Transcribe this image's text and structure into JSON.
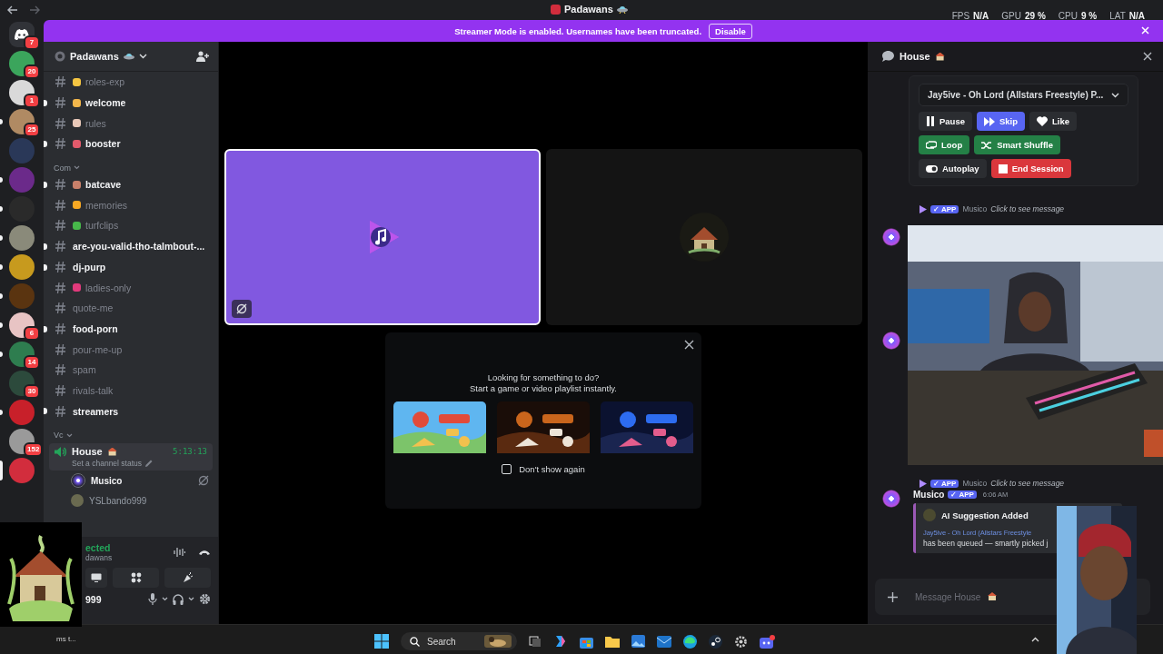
{
  "titlebar": {
    "title": "Padawans",
    "stats": [
      {
        "label": "FPS",
        "value": "N/A"
      },
      {
        "label": "GPU",
        "value": "29 %"
      },
      {
        "label": "CPU",
        "value": "9 %"
      },
      {
        "label": "LAT",
        "value": "N/A"
      }
    ]
  },
  "banner": {
    "text": "Streamer Mode is enabled. Usernames have been truncated.",
    "button": "Disable"
  },
  "servers": [
    {
      "kind": "home",
      "color": "#313338",
      "badge": "7",
      "unread": false,
      "selected": false
    },
    {
      "kind": "server",
      "color": "#3ba55c",
      "badge": "20",
      "unread": false,
      "selected": false
    },
    {
      "kind": "server",
      "color": "#d9d9d9",
      "badge": "1",
      "unread": false,
      "selected": false
    },
    {
      "kind": "server",
      "color": "#b08a63",
      "badge": "25",
      "unread": true,
      "selected": false
    },
    {
      "kind": "server",
      "color": "#2a3858",
      "unread": false,
      "selected": false
    },
    {
      "kind": "server",
      "color": "#6b2a8a",
      "unread": true,
      "selected": false
    },
    {
      "kind": "server",
      "color": "#2a2a2a",
      "unread": true,
      "selected": false
    },
    {
      "kind": "server",
      "color": "#8a8a7a",
      "unread": true,
      "selected": false
    },
    {
      "kind": "server",
      "color": "#c79a1e",
      "unread": true,
      "selected": false
    },
    {
      "kind": "server",
      "color": "#5a3410",
      "unread": true,
      "selected": false
    },
    {
      "kind": "server",
      "color": "#e8c4c4",
      "badge": "6",
      "unread": true,
      "selected": false
    },
    {
      "kind": "server",
      "color": "#2e7d4f",
      "badge": "14",
      "unread": true,
      "selected": false
    },
    {
      "kind": "server",
      "color": "#2c4a3c",
      "badge": "30",
      "unread": false,
      "selected": false
    },
    {
      "kind": "server",
      "color": "#c8202a",
      "unread": true,
      "selected": false
    },
    {
      "kind": "server",
      "color": "#9a9a9a",
      "badge": "152",
      "unread": false,
      "selected": false
    },
    {
      "kind": "server",
      "color": "#d22d3d",
      "unread": false,
      "selected": true
    }
  ],
  "server_header": {
    "name": "Padawans"
  },
  "channel_groups": [
    {
      "channels": [
        {
          "name": "roles-exp",
          "unread": false,
          "color": "#f5c542"
        },
        {
          "name": "welcome",
          "unread": true,
          "color": "#f2b64b"
        },
        {
          "name": "rules",
          "unread": false,
          "color": "#e9c9b9"
        },
        {
          "name": "booster",
          "unread": true,
          "color": "#e25a6b"
        }
      ]
    },
    {
      "name": "Com",
      "channels": [
        {
          "name": "batcave",
          "unread": true,
          "color": "#c9806a"
        },
        {
          "name": "memories",
          "unread": false,
          "color": "#f7a823"
        },
        {
          "name": "turfclips",
          "unread": false,
          "color": "#47b84a"
        },
        {
          "name": "are-you-valid-tho-talmbout-...",
          "unread": true
        },
        {
          "name": "dj-purp",
          "unread": true
        },
        {
          "name": "ladies-only",
          "unread": false,
          "color": "#e23a7c"
        },
        {
          "name": "quote-me",
          "unread": false
        },
        {
          "name": "food-porn",
          "unread": true
        },
        {
          "name": "pour-me-up",
          "unread": false
        },
        {
          "name": "spam",
          "unread": false
        },
        {
          "name": "rivals-talk",
          "unread": false
        },
        {
          "name": "streamers",
          "unread": true
        }
      ]
    }
  ],
  "voice_group": {
    "name": "Vc",
    "channel": {
      "name": "House",
      "timer": "5:13:13",
      "status": "Set a channel status",
      "members": [
        {
          "name": "Musico",
          "active": true
        },
        {
          "name": "YSLbando999",
          "active": false
        }
      ]
    }
  },
  "voice_panel": {
    "status": "ected",
    "server": "dawans",
    "user": "999"
  },
  "tiles": [
    {
      "kind": "music",
      "selected": true
    },
    {
      "kind": "avatar",
      "selected": false
    }
  ],
  "activity_popup": {
    "title": "Looking for something to do?",
    "subtitle": "Start a game or video playlist instantly.",
    "checkbox": {
      "label": "Don't show again",
      "checked": false
    }
  },
  "chat": {
    "title": "House",
    "player": {
      "track": "Jay5ive - Oh Lord (Allstars Freestyle) P...",
      "buttons": [
        {
          "label": "Pause",
          "kind": "neutral"
        },
        {
          "label": "Skip",
          "kind": "primary"
        },
        {
          "label": "Like",
          "kind": "neutral"
        },
        {
          "label": "Loop",
          "kind": "success"
        },
        {
          "label": "Smart Shuffle",
          "kind": "success"
        },
        {
          "label": "Autoplay",
          "kind": "neutral"
        },
        {
          "label": "End Session",
          "kind": "danger"
        }
      ]
    },
    "replies": [
      {
        "badge": "✓ APP",
        "author": "Musico",
        "preview": "Click to see message"
      },
      {
        "badge": "✓ APP",
        "author": "Musico",
        "preview": "Click to see message"
      }
    ],
    "message": {
      "author": "Musico",
      "badge": "✓ APP",
      "time": "6:06 AM",
      "embed": {
        "title": "AI Suggestion Added",
        "link": "Jay5ive - Oh Lord (Allstars Freestyle",
        "text": "has been queued — smartly picked j"
      }
    },
    "input_placeholder": "Message House"
  },
  "taskbar": {
    "notice": "ms t...",
    "search_placeholder": "Search"
  }
}
